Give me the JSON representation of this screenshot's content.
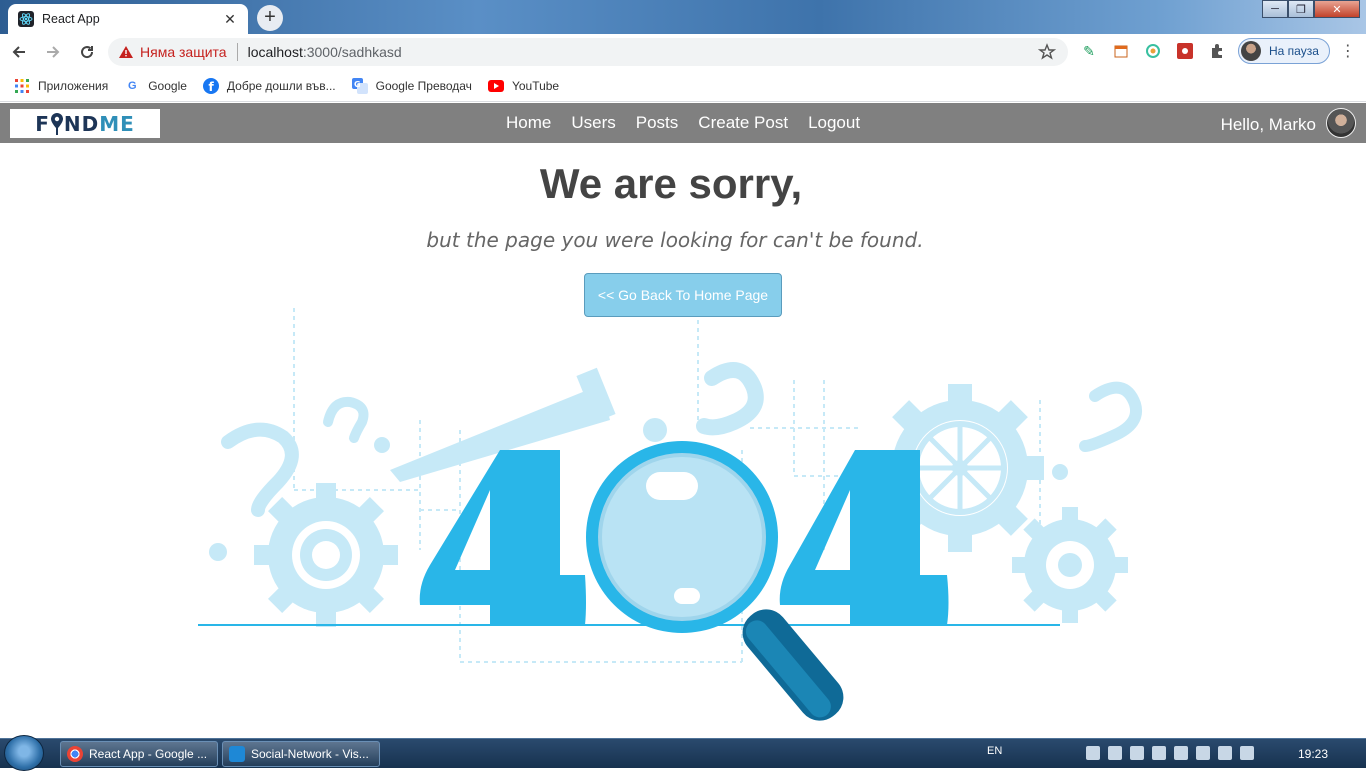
{
  "browser": {
    "tab_title": "React App",
    "tab_close": "✕",
    "new_tab": "+",
    "security_label": "Няма защита",
    "url_host": "localhost",
    "url_path": ":3000/sadhkasd",
    "profile_label": "На пауза",
    "window_controls": {
      "minimize": "─",
      "maximize": "❐",
      "close": "✕"
    }
  },
  "bookmarks": [
    {
      "label": "Приложения",
      "icon": "apps-grid-icon"
    },
    {
      "label": "Google",
      "icon": "google-icon"
    },
    {
      "label": "Добре дошли във...",
      "icon": "facebook-icon"
    },
    {
      "label": "Google Преводач",
      "icon": "translate-icon"
    },
    {
      "label": "YouTube",
      "icon": "youtube-icon"
    }
  ],
  "app": {
    "logo_part1": "F",
    "logo_part2": "ND",
    "logo_part3": "ME",
    "nav": [
      {
        "label": "Home"
      },
      {
        "label": "Users"
      },
      {
        "label": "Posts"
      },
      {
        "label": "Create Post"
      },
      {
        "label": "Logout"
      }
    ],
    "greeting": "Hello, Marko"
  },
  "content": {
    "heading": "We are sorry,",
    "subheading": "but the page you were looking for can't be found.",
    "back_button": "<< Go Back To Home Page",
    "illustration_text": "404"
  },
  "taskbar": {
    "items": [
      {
        "label": "React App - Google ..."
      },
      {
        "label": "Social-Network - Vis..."
      }
    ],
    "language": "EN",
    "clock": "19:23"
  },
  "colors": {
    "navbar_bg": "#808080",
    "accent_blue": "#29b6e8",
    "button_bg": "#87ceeb",
    "light_blue": "#c6e9f7"
  }
}
